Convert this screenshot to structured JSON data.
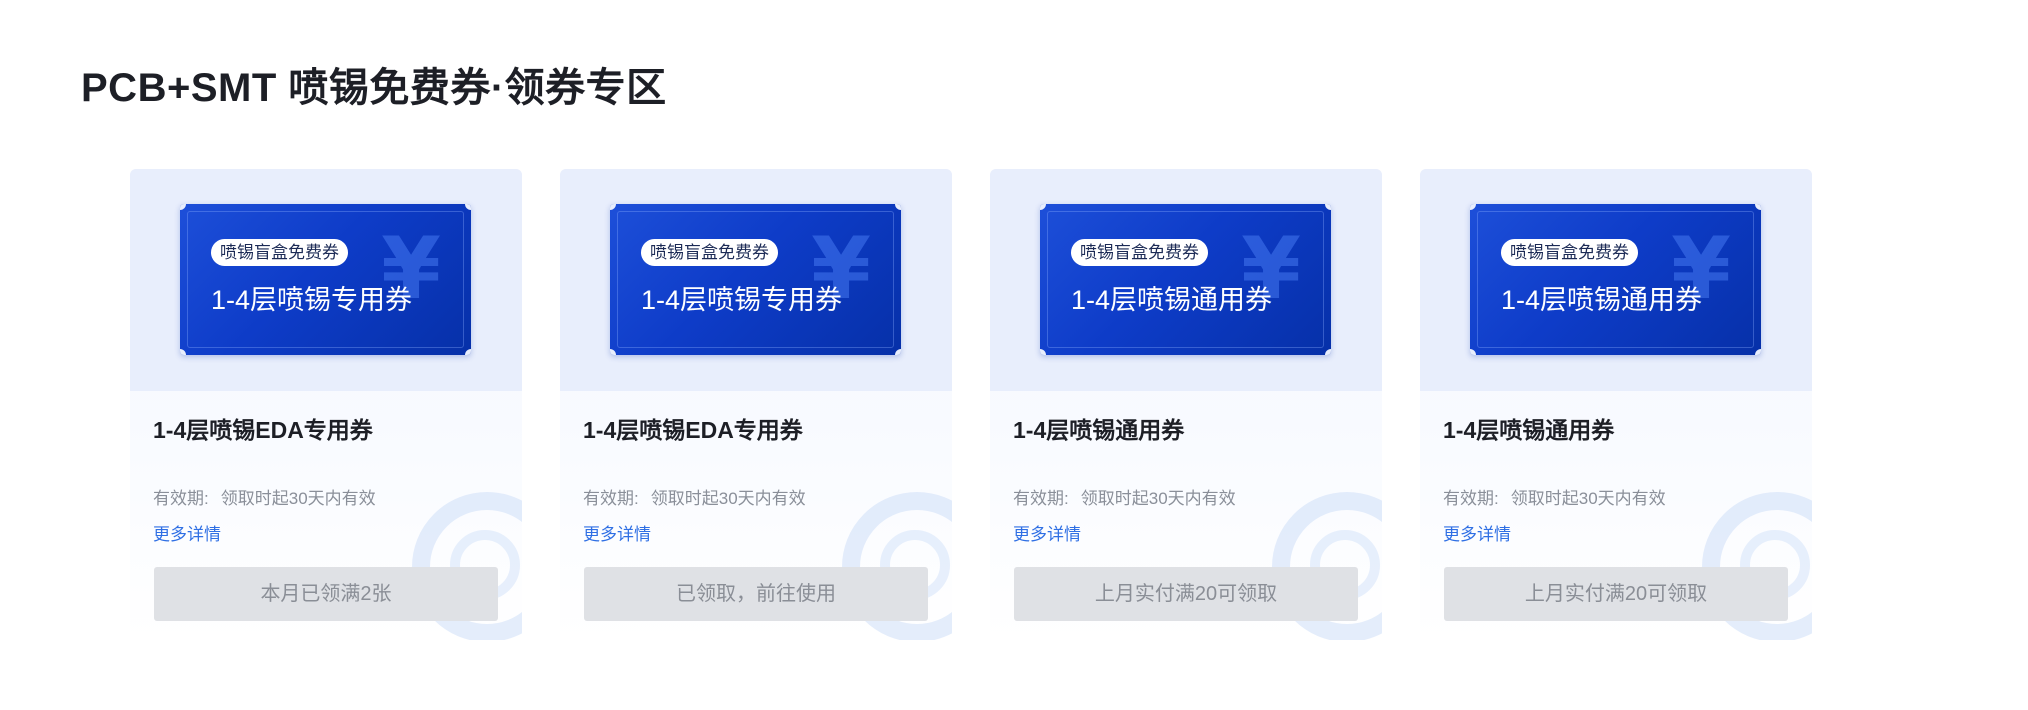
{
  "section": {
    "title": "PCB+SMT 喷锡免费券·领券专区"
  },
  "cards": [
    {
      "ticket_tag": "喷锡盲盒免费券",
      "ticket_name": "1-4层喷锡专用券",
      "yen_symbol": "¥",
      "title": "1-4层喷锡EDA专用券",
      "validity_label": "有效期:",
      "validity_value": "领取时起30天内有效",
      "more_link": "更多详情",
      "button_label": "本月已领满2张"
    },
    {
      "ticket_tag": "喷锡盲盒免费券",
      "ticket_name": "1-4层喷锡专用券",
      "yen_symbol": "¥",
      "title": "1-4层喷锡EDA专用券",
      "validity_label": "有效期:",
      "validity_value": "领取时起30天内有效",
      "more_link": "更多详情",
      "button_label": "已领取，前往使用"
    },
    {
      "ticket_tag": "喷锡盲盒免费券",
      "ticket_name": "1-4层喷锡通用券",
      "yen_symbol": "¥",
      "title": "1-4层喷锡通用券",
      "validity_label": "有效期:",
      "validity_value": "领取时起30天内有效",
      "more_link": "更多详情",
      "button_label": "上月实付满20可领取"
    },
    {
      "ticket_tag": "喷锡盲盒免费券",
      "ticket_name": "1-4层喷锡通用券",
      "yen_symbol": "¥",
      "title": "1-4层喷锡通用券",
      "validity_label": "有效期:",
      "validity_value": "领取时起30天内有效",
      "more_link": "更多详情",
      "button_label": "上月实付满20可领取"
    }
  ],
  "colors": {
    "ticket_blue": "#0e3cc8",
    "link_blue": "#2f6fe4",
    "button_disabled_bg": "#dfe1e5",
    "button_disabled_text": "#8a8e96"
  }
}
